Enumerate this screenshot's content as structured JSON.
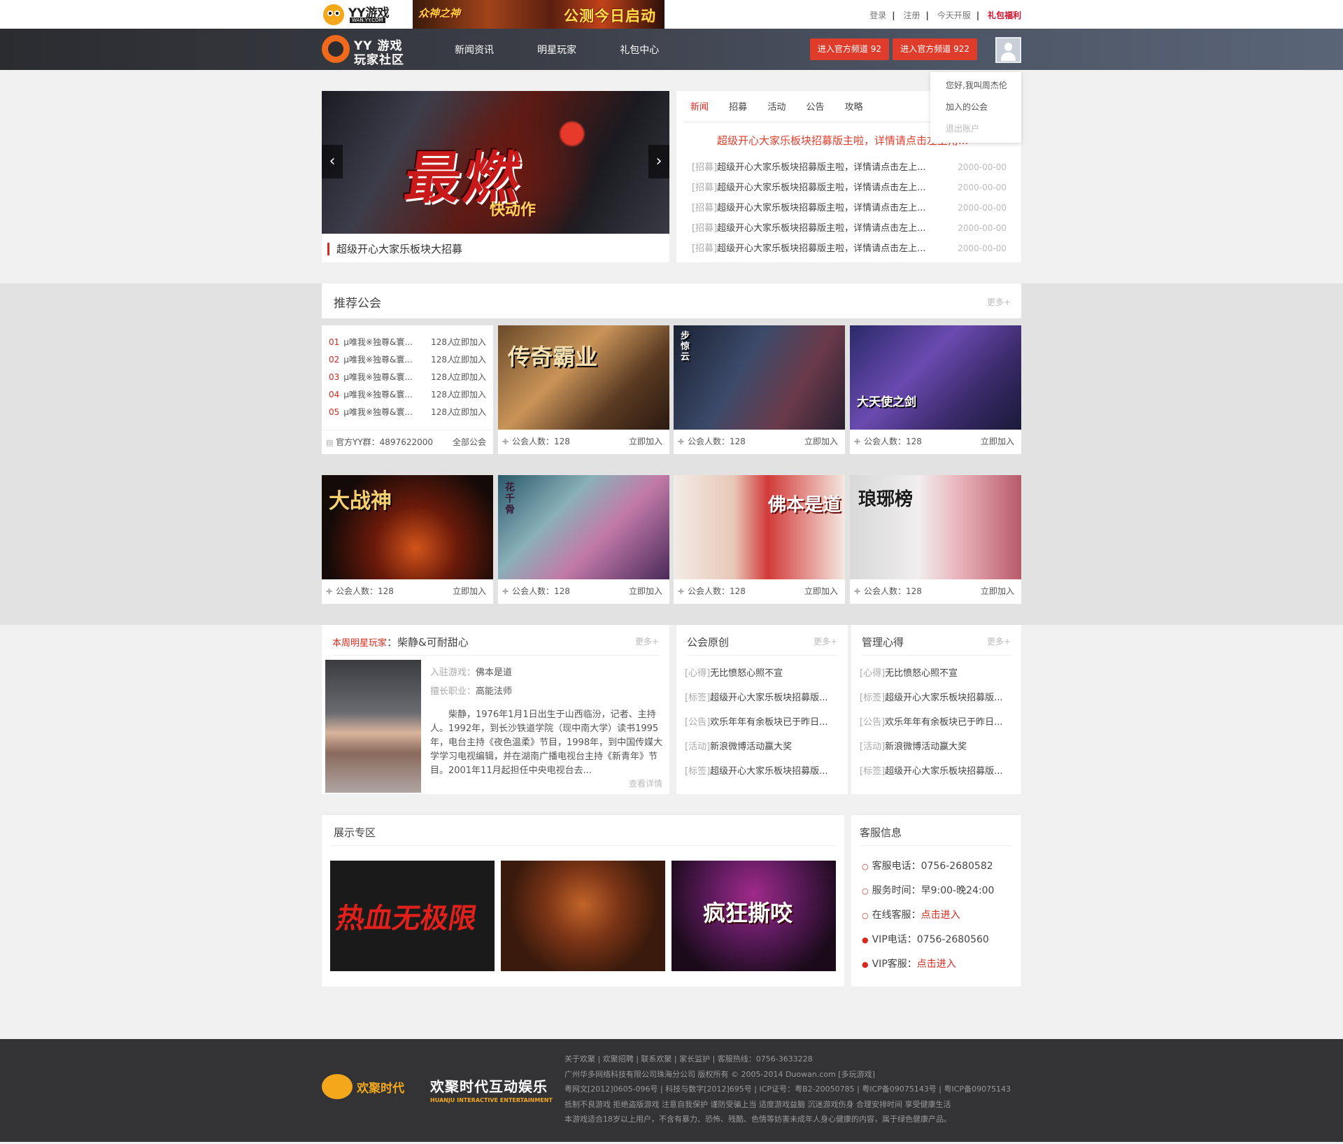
{
  "topbar": {
    "logo_text": "YY游戏",
    "logo_sub": "WAN.YY.COM",
    "banner_game": "众神之神",
    "banner_text": "公测今日启动",
    "links": [
      "登录",
      "注册",
      "今天开服"
    ],
    "gift": "礼包福利"
  },
  "nav": {
    "logo_line1": "YY 游戏",
    "logo_line2": "玩家社区",
    "items": [
      "新闻资讯",
      "明星玩家",
      "礼包中心"
    ],
    "btn1": "进入官方频道 92",
    "btn2": "进入官方频道 922"
  },
  "user_menu": {
    "greeting": "您好,我叫周杰伦",
    "joined": "加入的公会",
    "logout": "退出账户"
  },
  "slider": {
    "caption": "超级开心大家乐板块大招募",
    "art_big": "最燃",
    "art_small": "快动作",
    "prev": "‹",
    "next": "›"
  },
  "news": {
    "tabs": [
      "新闻",
      "招募",
      "活动",
      "公告",
      "攻略"
    ],
    "headline": "超级开心大家乐板块招募版主啦，详情请点击左上角...",
    "rows": [
      {
        "tag": "[招募]",
        "title": "超级开心大家乐板块招募版主啦，详情请点击左上...",
        "date": "2000-00-00"
      },
      {
        "tag": "[招募]",
        "title": "超级开心大家乐板块招募版主啦，详情请点击左上...",
        "date": "2000-00-00"
      },
      {
        "tag": "[招募]",
        "title": "超级开心大家乐板块招募版主啦，详情请点击左上...",
        "date": "2000-00-00"
      },
      {
        "tag": "[招募]",
        "title": "超级开心大家乐板块招募版主啦，详情请点击左上...",
        "date": "2000-00-00"
      },
      {
        "tag": "[招募]",
        "title": "超级开心大家乐板块招募版主啦，详情请点击左上...",
        "date": "2000-00-00"
      }
    ]
  },
  "guild": {
    "title": "推荐公会",
    "more": "更多+",
    "rank_rows": [
      {
        "num": "01",
        "name": "μ唯我※独尊&寰...",
        "count": "128人",
        "join": "立即加入"
      },
      {
        "num": "02",
        "name": "μ唯我※独尊&寰...",
        "count": "128人",
        "join": "立即加入"
      },
      {
        "num": "03",
        "name": "μ唯我※独尊&寰...",
        "count": "128人",
        "join": "立即加入"
      },
      {
        "num": "04",
        "name": "μ唯我※独尊&寰...",
        "count": "128人",
        "join": "立即加入"
      },
      {
        "num": "05",
        "name": "μ唯我※独尊&寰...",
        "count": "128人",
        "join": "立即加入"
      }
    ],
    "rank_foot": "官方YY群：4897622000",
    "rank_all": "全部公会",
    "cards": [
      {
        "art": "传奇霸业",
        "members": "公会人数：128",
        "join": "立即加入"
      },
      {
        "art": "步惊云",
        "members": "公会人数：128",
        "join": "立即加入"
      },
      {
        "art": "大天使之剑",
        "members": "公会人数：128",
        "join": "立即加入"
      },
      {
        "art": "大战神",
        "members": "公会人数：128",
        "join": "立即加入"
      },
      {
        "art": "花千骨",
        "members": "公会人数：128",
        "join": "立即加入"
      },
      {
        "art": "佛本是道",
        "members": "公会人数：128",
        "join": "立即加入"
      },
      {
        "art": "琅琊榜",
        "members": "公会人数：128",
        "join": "立即加入"
      }
    ]
  },
  "star": {
    "label": "本周明星玩家",
    "name": "：柴静&可耐甜心",
    "more": "更多+",
    "game_label": "入驻游戏：",
    "game": "佛本是道",
    "job_label": "擅长职业：",
    "job": "高能法师",
    "bio": "柴静，1976年1月1日出生于山西临汾，记者、主持人。1992年，到长沙铁道学院（现中南大学）读书1995年，电台主持《夜色温柔》节目，1998年，到中国传媒大学学习电视编辑，并在湖南广播电视台主持《新青年》节目。2001年11月起担任中央电视台去...",
    "detail": "查看详情"
  },
  "original": {
    "title": "公会原创",
    "more": "更多+",
    "rows": [
      {
        "tag": "[心得]",
        "title": "无比愤怒心照不宣"
      },
      {
        "tag": "[标签]",
        "title": "超级开心大家乐板块招募版..."
      },
      {
        "tag": "[公告]",
        "title": "欢乐年年有余板块已于昨日..."
      },
      {
        "tag": "[活动]",
        "title": "新浪微博活动赢大奖"
      },
      {
        "tag": "[标签]",
        "title": "超级开心大家乐板块招募版..."
      }
    ]
  },
  "manage": {
    "title": "管理心得",
    "more": "更多+",
    "rows": [
      {
        "tag": "[心得]",
        "title": "无比愤怒心照不宣"
      },
      {
        "tag": "[标签]",
        "title": "超级开心大家乐板块招募版..."
      },
      {
        "tag": "[公告]",
        "title": "欢乐年年有余板块已于昨日..."
      },
      {
        "tag": "[活动]",
        "title": "新浪微博活动赢大奖"
      },
      {
        "tag": "[标签]",
        "title": "超级开心大家乐板块招募版..."
      }
    ]
  },
  "showcase": {
    "title": "展示专区",
    "items": [
      "热血无极限",
      "",
      "疯狂撕咬"
    ]
  },
  "service": {
    "title": "客服信息",
    "phone_label": "客服电话：",
    "phone": "0756-2680582",
    "hours_label": "服务时间：",
    "hours": "早9:00-晚24:00",
    "online_label": "在线客服：",
    "online": "点击进入",
    "vip_phone_label": "VIP电话：",
    "vip_phone": "0756-2680560",
    "vip_label": "VIP客服：",
    "vip": "点击进入"
  },
  "footer": {
    "logo1": "欢聚时代",
    "logo2": "欢聚时代互动娱乐",
    "logo2_sub": "HUANJU INTERACTIVE ENTERTAINMENT",
    "lines": [
      "关于欢聚 | 欢聚招聘 | 联系欢聚 | 家长监护 | 客服热线：0756-3633228",
      "广州华多网络科技有限公司珠海分公司 版权所有 © 2005-2014 Duowan.com [多玩游戏]",
      "粤网文[2012]0605-096号 | 科技与数字[2012]695号 | ICP证号：粤B2-20050785 | 粤ICP备09075143号 | 粤ICP备09075143",
      "抵制不良游戏 拒绝盗版游戏 注意自我保护 谨防受骗上当 适度游戏益脑 沉迷游戏伤身 合理安排时间 享受健康生活",
      "本游戏适合18岁以上用户，不含有暴力、恐怖、残酷、色情等妨害未成年人身心健康的内容，属于绿色健康产品。"
    ]
  },
  "colors": {
    "accent": "#d9281e",
    "nav_bg": "#2b2c30",
    "footer_bg": "#333336"
  }
}
